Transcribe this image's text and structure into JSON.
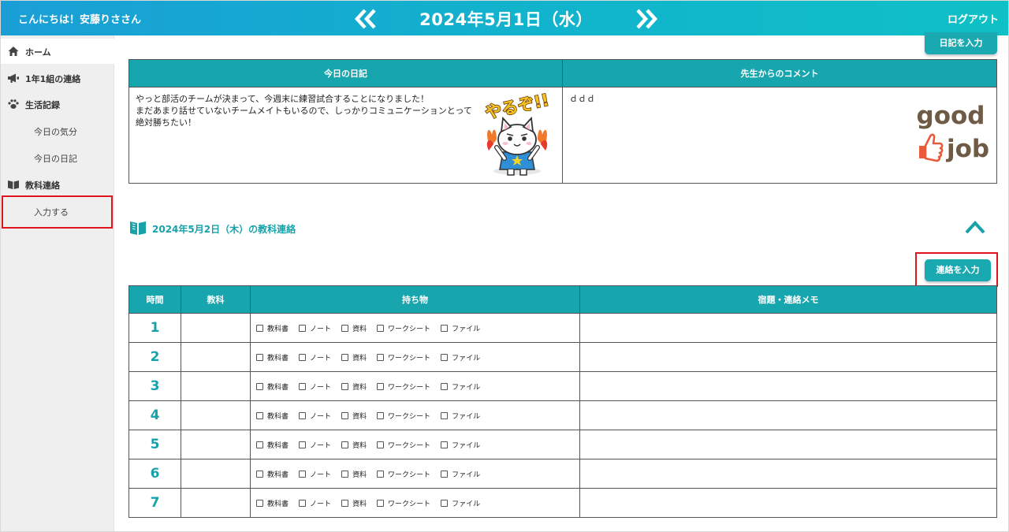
{
  "header": {
    "greeting": "こんにちは！安藤りささん",
    "date_title": "2024年5月1日（水）",
    "logout_label": "ログアウト",
    "prev_icon": "double-chevron-left-icon",
    "next_icon": "double-chevron-right-icon"
  },
  "sidebar": {
    "items": [
      {
        "label": "ホーム",
        "icon": "home-icon"
      },
      {
        "label": "1年1組の連絡",
        "icon": "megaphone-icon"
      },
      {
        "label": "生活記録",
        "icon": "paw-icon"
      },
      {
        "label": "今日の気分"
      },
      {
        "label": "今日の日記"
      },
      {
        "label": "教科連絡",
        "icon": "book-icon"
      },
      {
        "label": "入力する"
      }
    ]
  },
  "diary": {
    "button_label": "日記を入力",
    "col_diary": "今日の日記",
    "col_comment": "先生からのコメント",
    "diary_text": "やっと部活のチームが決まって、今週末に練習試合することになりました！\nまだあまり話せていないチームメイトもいるので、しっかりコミュニケーションとって\n絶対勝ちたい！",
    "comment_text": "ｄｄｄ",
    "sticker_text": "やるぞ!!",
    "stamp_line1": "good",
    "stamp_line2": "job"
  },
  "subject_contact": {
    "section_title": "2024年5月2日（木）の教科連絡",
    "button_label": "連絡を入力",
    "columns": [
      "時間",
      "教科",
      "持ち物",
      "宿題・連絡メモ"
    ],
    "item_options": [
      "教科書",
      "ノート",
      "資料",
      "ワークシート",
      "ファイル"
    ],
    "rows": [
      {
        "period": "1",
        "subject": "",
        "memo": ""
      },
      {
        "period": "2",
        "subject": "",
        "memo": ""
      },
      {
        "period": "3",
        "subject": "",
        "memo": ""
      },
      {
        "period": "4",
        "subject": "",
        "memo": ""
      },
      {
        "period": "5",
        "subject": "",
        "memo": ""
      },
      {
        "period": "6",
        "subject": "",
        "memo": ""
      },
      {
        "period": "7",
        "subject": "",
        "memo": ""
      }
    ]
  },
  "colors": {
    "accent": "#18a6ae",
    "header_start": "#1a9ed6",
    "header_end": "#0fc0c6",
    "highlight": "#e0141c"
  }
}
